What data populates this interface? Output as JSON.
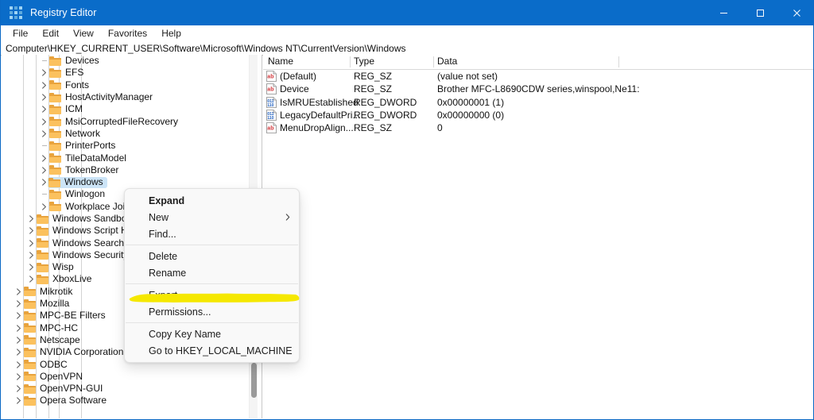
{
  "window": {
    "title": "Registry Editor",
    "app_icon": "registry-grid-icon",
    "minimize_icon": "minimize-icon",
    "maximize_icon": "maximize-icon",
    "close_icon": "close-icon",
    "titlebar_color": "#0a6cc9"
  },
  "menubar": {
    "items": [
      {
        "label": "File"
      },
      {
        "label": "Edit"
      },
      {
        "label": "View"
      },
      {
        "label": "Favorites"
      },
      {
        "label": "Help"
      }
    ]
  },
  "address": {
    "path": "Computer\\HKEY_CURRENT_USER\\Software\\Microsoft\\Windows NT\\CurrentVersion\\Windows"
  },
  "tree": {
    "selected": "Windows",
    "scrollbar": {
      "thumb_top_pct": 85
    },
    "items": [
      {
        "label": "Devices",
        "indent": 5,
        "expandable": false,
        "selected": false
      },
      {
        "label": "EFS",
        "indent": 5,
        "expandable": true,
        "selected": false
      },
      {
        "label": "Fonts",
        "indent": 5,
        "expandable": true,
        "selected": false
      },
      {
        "label": "HostActivityManager",
        "indent": 5,
        "expandable": true,
        "selected": false
      },
      {
        "label": "ICM",
        "indent": 5,
        "expandable": true,
        "selected": false
      },
      {
        "label": "MsiCorruptedFileRecovery",
        "indent": 5,
        "expandable": true,
        "selected": false
      },
      {
        "label": "Network",
        "indent": 5,
        "expandable": true,
        "selected": false
      },
      {
        "label": "PrinterPorts",
        "indent": 5,
        "expandable": false,
        "selected": false
      },
      {
        "label": "TileDataModel",
        "indent": 5,
        "expandable": true,
        "selected": false
      },
      {
        "label": "TokenBroker",
        "indent": 5,
        "expandable": true,
        "selected": false
      },
      {
        "label": "Windows",
        "indent": 5,
        "expandable": true,
        "selected": true
      },
      {
        "label": "Winlogon",
        "indent": 5,
        "expandable": false,
        "selected": false
      },
      {
        "label": "Workplace Join",
        "indent": 5,
        "expandable": true,
        "selected": false
      },
      {
        "label": "Windows Sandbox",
        "indent": 4,
        "expandable": true,
        "selected": false
      },
      {
        "label": "Windows Script Host",
        "indent": 4,
        "expandable": true,
        "selected": false
      },
      {
        "label": "Windows Search",
        "indent": 4,
        "expandable": true,
        "selected": false
      },
      {
        "label": "Windows Security Health",
        "indent": 4,
        "expandable": true,
        "selected": false
      },
      {
        "label": "Wisp",
        "indent": 4,
        "expandable": true,
        "selected": false
      },
      {
        "label": "XboxLive",
        "indent": 4,
        "expandable": true,
        "selected": false
      },
      {
        "label": "Mikrotik",
        "indent": 3,
        "expandable": true,
        "selected": false
      },
      {
        "label": "Mozilla",
        "indent": 3,
        "expandable": true,
        "selected": false
      },
      {
        "label": "MPC-BE Filters",
        "indent": 3,
        "expandable": true,
        "selected": false
      },
      {
        "label": "MPC-HC",
        "indent": 3,
        "expandable": true,
        "selected": false
      },
      {
        "label": "Netscape",
        "indent": 3,
        "expandable": true,
        "selected": false
      },
      {
        "label": "NVIDIA Corporation",
        "indent": 3,
        "expandable": true,
        "selected": false
      },
      {
        "label": "ODBC",
        "indent": 3,
        "expandable": true,
        "selected": false
      },
      {
        "label": "OpenVPN",
        "indent": 3,
        "expandable": true,
        "selected": false
      },
      {
        "label": "OpenVPN-GUI",
        "indent": 3,
        "expandable": true,
        "selected": false
      },
      {
        "label": "Opera Software",
        "indent": 3,
        "expandable": true,
        "selected": false
      }
    ]
  },
  "values": {
    "columns": [
      "Name",
      "Type",
      "Data"
    ],
    "rows": [
      {
        "icon": "string-value-icon",
        "name": "(Default)",
        "type": "REG_SZ",
        "data": "(value not set)"
      },
      {
        "icon": "string-value-icon",
        "name": "Device",
        "type": "REG_SZ",
        "data": "Brother MFC-L8690CDW series,winspool,Ne11:"
      },
      {
        "icon": "dword-value-icon",
        "name": "IsMRUEstablished",
        "type": "REG_DWORD",
        "data": "0x00000001 (1)"
      },
      {
        "icon": "dword-value-icon",
        "name": "LegacyDefaultPri...",
        "type": "REG_DWORD",
        "data": "0x00000000 (0)"
      },
      {
        "icon": "string-value-icon",
        "name": "MenuDropAlign...",
        "type": "REG_SZ",
        "data": "0"
      }
    ]
  },
  "context_menu": {
    "groups": [
      [
        {
          "label": "Expand",
          "bold": true,
          "submenu": false
        },
        {
          "label": "New",
          "bold": false,
          "submenu": true
        },
        {
          "label": "Find...",
          "bold": false,
          "submenu": false
        }
      ],
      [
        {
          "label": "Delete",
          "bold": false,
          "submenu": false
        },
        {
          "label": "Rename",
          "bold": false,
          "submenu": false
        }
      ],
      [
        {
          "label": "Export",
          "bold": false,
          "submenu": false
        },
        {
          "label": "Permissions...",
          "bold": false,
          "submenu": false,
          "highlighted": true
        }
      ],
      [
        {
          "label": "Copy Key Name",
          "bold": false,
          "submenu": false
        },
        {
          "label": "Go to HKEY_LOCAL_MACHINE",
          "bold": false,
          "submenu": false
        }
      ]
    ]
  },
  "annotation": {
    "type": "highlighter-stroke",
    "color": "#f5e800",
    "target": "Permissions..."
  }
}
